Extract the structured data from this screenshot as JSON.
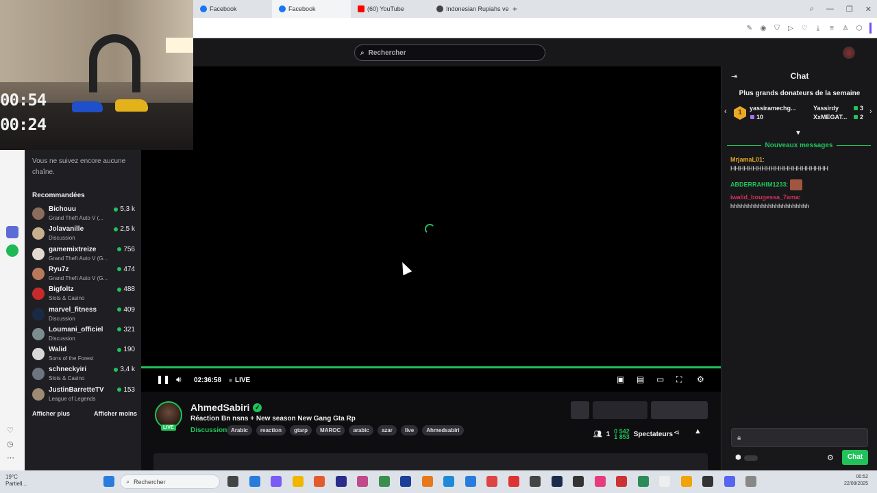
{
  "browser": {
    "tabs": [
      {
        "label": "Facebook",
        "color": "#1877f2"
      },
      {
        "label": "Facebook",
        "color": "#1877f2"
      },
      {
        "label": "(60) YouTube",
        "color": "#ff0000"
      },
      {
        "label": "Indonesian Rupiahs vers N",
        "color": "#444444"
      }
    ],
    "new_tab": "+"
  },
  "webcam": {
    "clock_top": "00:54",
    "clock_bottom": "00:24"
  },
  "topnav": {
    "search_placeholder": "Rechercher"
  },
  "sidebar": {
    "no_follow_text": "Vous ne suivez encore aucune chaîne.",
    "recommended_title": "Recommandées",
    "channels": [
      {
        "name": "Bichouu",
        "game": "Grand Theft Auto V (...",
        "viewers": "5,3 k",
        "color": "#8a6d5c"
      },
      {
        "name": "Jolavanille",
        "game": "Discussion",
        "viewers": "2,5 k",
        "color": "#c7b08e"
      },
      {
        "name": "gamemixtreize",
        "game": "Grand Theft Auto V (G...",
        "viewers": "756",
        "color": "#e2dad0"
      },
      {
        "name": "Ryu7z",
        "game": "Grand Theft Auto V (G...",
        "viewers": "474",
        "color": "#b9795b"
      },
      {
        "name": "Bigfoltz",
        "game": "Slots & Casino",
        "viewers": "488",
        "color": "#c62b2b"
      },
      {
        "name": "marvel_fitness",
        "game": "Discussion",
        "viewers": "409",
        "color": "#1b2a44"
      },
      {
        "name": "Loumani_officiel",
        "game": "Discussion",
        "viewers": "321",
        "color": "#7d8c8f"
      },
      {
        "name": "Walid",
        "game": "Sons of the Forest",
        "viewers": "190",
        "color": "#d8d8d8"
      },
      {
        "name": "schneckyiri",
        "game": "Slots & Casino",
        "viewers": "3,4 k",
        "color": "#6c7580"
      },
      {
        "name": "JustinBarretteTV",
        "game": "League of Legends",
        "viewers": "153",
        "color": "#9d8b73"
      }
    ],
    "show_more": "Afficher plus",
    "show_less": "Afficher moins"
  },
  "player": {
    "time": "02:36:58",
    "live": "LIVE",
    "progress": 1.0
  },
  "stream": {
    "streamer": "AhmedSabiri",
    "live_badge": "LIVE",
    "title": "Réaction Bn nsns + New season New Gang Gta Rp",
    "category": "Discussion",
    "tags": [
      "Arabic",
      "reaction",
      "gtarp",
      "MAROC",
      "arabic",
      "azar",
      "live",
      "Ahmedsabiri"
    ],
    "viewers_top": "0 542",
    "viewers_bottom": "1 853",
    "viewers_prefix": "1",
    "viewers_label": "Spectateurs"
  },
  "chat": {
    "title": "Chat",
    "donors_title": "Plus grands donateurs de la semaine",
    "donors": [
      {
        "rank": "1",
        "name": "yassiramechg...",
        "value": "10",
        "name_color": "#e9a825",
        "value_color": "#a970ff"
      },
      {
        "name": "Yassirdy",
        "value": "3",
        "name_color": "#c9c9cf",
        "value_color": "#20c35a"
      },
      {
        "name": "XxMEGAT...",
        "value": "2",
        "name_color": "#e9a825",
        "value_color": "#20c35a"
      }
    ],
    "new_messages": "Nouveaux messages",
    "messages": [
      {
        "user": "MrjamaL01",
        "sep": ":",
        "text": "HHHHHHHHHHHHHHHHHHHHHH",
        "color": "#e9a825"
      },
      {
        "user": "ABDERRAHIM1233",
        "sep": ":",
        "text": "",
        "color": "#20c35a"
      },
      {
        "user": "iwalid_bougessa_7ama",
        "sep": ":",
        "text": "hhhhhhhhhhhhhhhhhhhhhhh",
        "color": "#d2325a"
      }
    ],
    "send_label": "Chat"
  },
  "taskbar": {
    "search": "Rechercher",
    "weather_top": "19°C",
    "weather_bottom": "Partiell...",
    "clock_time": "00:52",
    "clock_date": "22/08/2025"
  }
}
